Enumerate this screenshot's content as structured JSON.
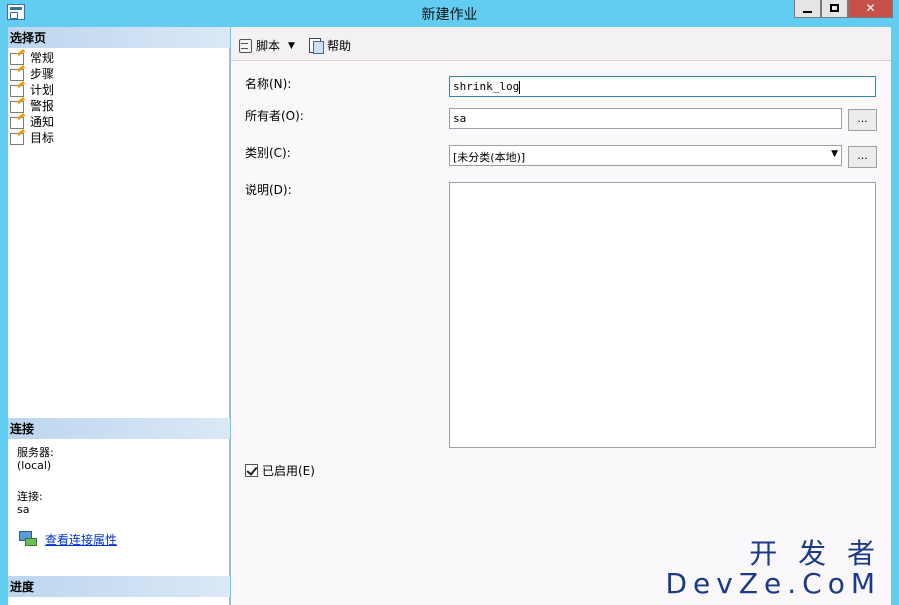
{
  "window": {
    "title": "新建作业"
  },
  "left": {
    "select_page_header": "选择页",
    "nav_items": [
      {
        "label": "常规"
      },
      {
        "label": "步骤"
      },
      {
        "label": "计划"
      },
      {
        "label": "警报"
      },
      {
        "label": "通知"
      },
      {
        "label": "目标"
      }
    ],
    "connection_header": "连接",
    "server_label": "服务器:",
    "server_value": "(local)",
    "connection_label": "连接:",
    "connection_value": "sa",
    "view_connection_link": "查看连接属性",
    "progress_header": "进度"
  },
  "toolbar": {
    "script_label": "脚本",
    "help_label": "帮助"
  },
  "form": {
    "name_label": "名称(N):",
    "name_value": "shrink_log",
    "owner_label": "所有者(O):",
    "owner_value": "sa",
    "owner_browse": "...",
    "category_label": "类别(C):",
    "category_value": "[未分类(本地)]",
    "category_browse": "...",
    "description_label": "说明(D):",
    "description_value": "",
    "enabled_label": "已启用(E)",
    "enabled": true
  },
  "watermark": {
    "line1": "开 发 者",
    "line2": "DevZe.CoM"
  }
}
